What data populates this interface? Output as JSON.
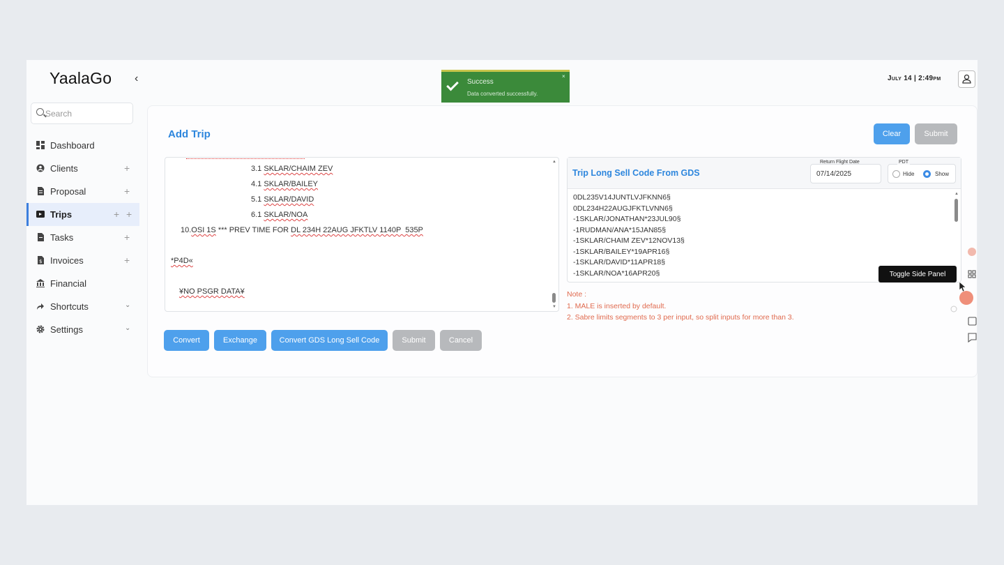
{
  "app": {
    "logo": "YaalaGo",
    "collapse_icon": "chevron-left-icon"
  },
  "header": {
    "datetime": "July 14 | 2:49pm"
  },
  "search": {
    "placeholder": "Search"
  },
  "sidebar": {
    "items": [
      {
        "label": "Dashboard",
        "icon": "dashboard-icon"
      },
      {
        "label": "Clients",
        "icon": "clients-icon",
        "plus": "+"
      },
      {
        "label": "Proposal",
        "icon": "document-icon",
        "plus": "+"
      },
      {
        "label": "Trips",
        "icon": "trips-icon",
        "plus": "+",
        "plus2": "+",
        "active": true
      },
      {
        "label": "Tasks",
        "icon": "tasks-icon",
        "plus": "+"
      },
      {
        "label": "Invoices",
        "icon": "invoice-icon",
        "plus": "+"
      },
      {
        "label": "Financial",
        "icon": "bank-icon"
      },
      {
        "label": "Shortcuts",
        "icon": "shortcut-icon",
        "chevron": "⌄"
      },
      {
        "label": "Settings",
        "icon": "gear-icon",
        "chevron": "⌄"
      }
    ]
  },
  "toast": {
    "title": "Success",
    "message": "Data converted successfully.",
    "close": "×"
  },
  "page": {
    "title": "Add Trip",
    "clear_label": "Clear",
    "submit_top_label": "Submit"
  },
  "editor": {
    "lines": [
      {
        "num": "3.1 ",
        "text": "SKLAR/CHAIM ZEV"
      },
      {
        "num": "4.1 ",
        "text": "SKLAR/BAILEY"
      },
      {
        "num": "5.1 ",
        "text": "SKLAR/DAVID"
      },
      {
        "num": "6.1 ",
        "text": "SKLAR/NOA"
      }
    ],
    "osi_line_a": "10.",
    "osi_line_b": "OSI 1S",
    "osi_line_c": " *** PREV TIME FOR ",
    "osi_line_d": "DL 234H 22AUG JFKTLV 1140P  535P",
    "p4d": "*P4D«",
    "no_psgr": "¥NO PSGR DATA¥"
  },
  "actions": {
    "convert": "Convert",
    "exchange": "Exchange",
    "convert_gds": "Convert GDS Long Sell Code",
    "submit": "Submit",
    "cancel": "Cancel"
  },
  "gds": {
    "title": "Trip Long Sell Code From GDS",
    "return_flight_label": "Return Flight Date",
    "return_flight_value": "07/14/2025",
    "pdt_label": "PDT",
    "hide_label": "Hide",
    "show_label": "Show",
    "lines": [
      "0DL235V14JUNTLVJFKNN6§",
      "0DL234H22AUGJFKTLVNN6§",
      "-1SKLAR/JONATHAN*23JUL90§",
      "-1RUDMAN/ANA*15JAN85§",
      "-1SKLAR/CHAIM ZEV*12NOV13§",
      "-1SKLAR/BAILEY*19APR16§",
      "-1SKLAR/DAVID*11APR18§",
      "-1SKLAR/NOA*16APR20§"
    ]
  },
  "notes": {
    "heading": "Note :",
    "items": [
      "1. MALE is inserted by default.",
      "2. Sabre limits segments to 3 per input, so split inputs for more than 3."
    ]
  },
  "tooltip": {
    "text": "Toggle Side Panel"
  },
  "colors": {
    "accent": "#2d86dd",
    "button_blue": "#4ea0ec",
    "button_grey": "#b7b9bc",
    "toast_green": "#3b8a3a",
    "note_red": "#e06a4e"
  }
}
